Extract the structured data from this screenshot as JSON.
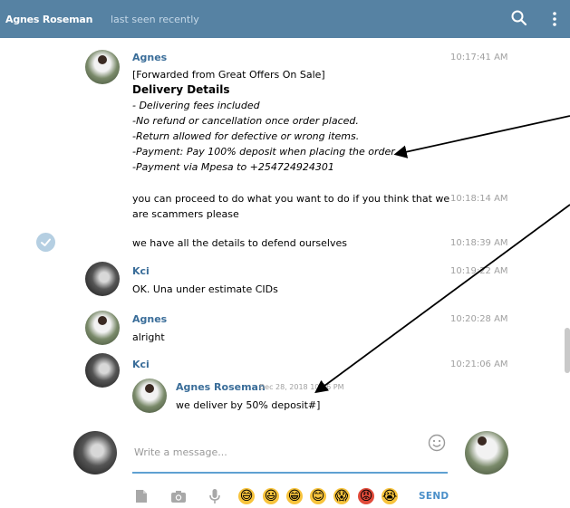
{
  "header": {
    "contact_name": "Agnes Roseman",
    "status": "last seen recently",
    "search_icon": "search-icon",
    "menu_icon": "more-vertical-icon"
  },
  "messages": [
    {
      "sender": "Agnes",
      "time": "10:17:41 AM",
      "forwarded": "[Forwarded from Great Offers On Sale]",
      "heading": "Delivery Details",
      "lines": [
        "- Delivering fees included",
        "-No refund  or  cancellation once order placed.",
        "-Return allowed for defective or wrong items.",
        "-Payment:  Pay 100% deposit when placing the order",
        "-Payment via Mpesa to +254724924301"
      ]
    },
    {
      "time": "10:18:14 AM",
      "text_line1": "you can proceed to do what you want to do if you think that we",
      "text_line2": "are scammers please"
    },
    {
      "time": "10:18:39 AM",
      "text": "we have all the details to defend ourselves"
    },
    {
      "sender": "Kci",
      "time": "10:19:22 AM",
      "text": "OK. Una under estimate CIDs"
    },
    {
      "sender": "Agnes",
      "time": "10:20:28 AM",
      "text": "alright"
    },
    {
      "sender": "Kci",
      "time": "10:21:06 AM",
      "reply": {
        "name": "Agnes Roseman",
        "date": "Dec 28, 2018 10:46 PM",
        "text": "we deliver by 50% deposit#]"
      }
    }
  ],
  "composer": {
    "placeholder": "Write a message...",
    "send_label": "SEND"
  },
  "toolbar_icons": [
    "file-icon",
    "camera-icon",
    "microphone-icon"
  ],
  "emojis": [
    "😅",
    "😃",
    "😁",
    "😊",
    "😱",
    "😡",
    "😭"
  ],
  "colors": {
    "header_bg": "#5682a3",
    "sender_name": "#3a6d99",
    "accent": "#4a8fc9"
  }
}
